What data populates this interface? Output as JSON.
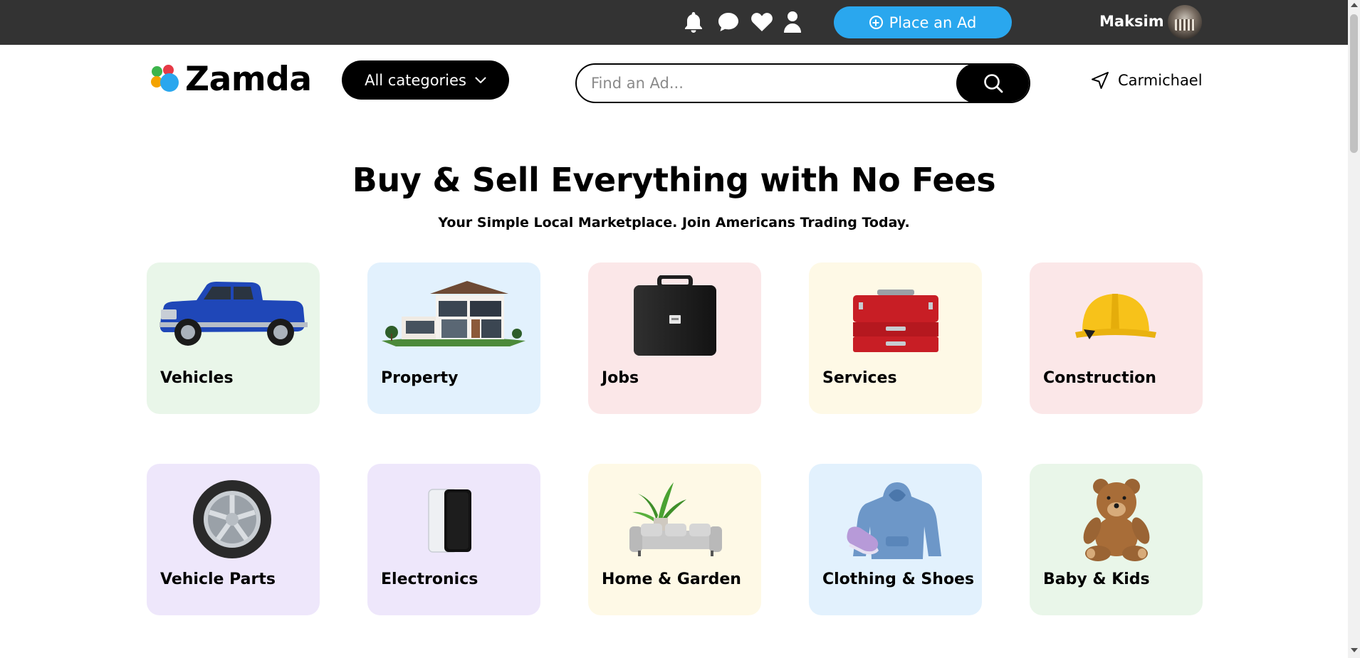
{
  "topbar": {
    "icons": [
      "bell-icon",
      "chat-icon",
      "heart-icon",
      "user-icon"
    ],
    "place_ad_label": "Place an Ad",
    "username": "Maksim"
  },
  "header": {
    "logo_text": "Zamda",
    "categories_button": "All categories",
    "search": {
      "placeholder": "Find an Ad...",
      "value": ""
    },
    "location": "Carmichael"
  },
  "hero": {
    "title": "Buy & Sell Everything with No Fees",
    "subtitle": "Your Simple Local Marketplace. Join Americans Trading Today."
  },
  "categories": [
    {
      "label": "Vehicles",
      "bg": "#e9f6e9",
      "icon": "pickup-truck-image"
    },
    {
      "label": "Property",
      "bg": "#e2f1fd",
      "icon": "modern-house-image"
    },
    {
      "label": "Jobs",
      "bg": "#fbe7e8",
      "icon": "briefcase-image"
    },
    {
      "label": "Services",
      "bg": "#fef9e6",
      "icon": "toolbox-image"
    },
    {
      "label": "Construction",
      "bg": "#fbe7e8",
      "icon": "hard-hat-image"
    },
    {
      "label": "Vehicle Parts",
      "bg": "#eee7fb",
      "icon": "tire-wheel-image"
    },
    {
      "label": "Electronics",
      "bg": "#eee7fb",
      "icon": "smartphones-image"
    },
    {
      "label": "Home & Garden",
      "bg": "#fef9e6",
      "icon": "sofa-plant-image"
    },
    {
      "label": "Clothing & Shoes",
      "bg": "#e2f1fd",
      "icon": "hoodie-sneaker-image"
    },
    {
      "label": "Baby & Kids",
      "bg": "#e9f6e9",
      "icon": "teddy-bear-image"
    }
  ],
  "colors": {
    "topbar": "#333333",
    "accent": "#2aa7ee",
    "logo_dots": [
      "#e63946",
      "#f4a300",
      "#2aa7ee",
      "#3cb44b"
    ]
  }
}
